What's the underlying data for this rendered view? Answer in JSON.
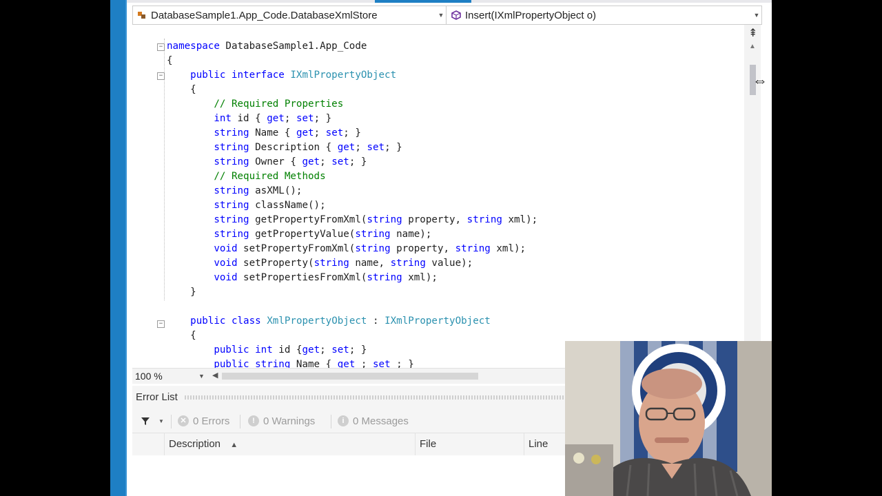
{
  "nav": {
    "left_label": "DatabaseSample1.App_Code.DatabaseXmlStore",
    "right_label": "Insert(IXmlPropertyObject o)"
  },
  "code_lines": [
    {
      "parts": [
        [
          "kw",
          "namespace"
        ],
        [
          "tx",
          " DatabaseSample1.App_Code"
        ]
      ]
    },
    {
      "parts": [
        [
          "tx",
          "{"
        ]
      ]
    },
    {
      "parts": [
        [
          "tx",
          "    "
        ],
        [
          "kw",
          "public"
        ],
        [
          "tx",
          " "
        ],
        [
          "kw",
          "interface"
        ],
        [
          "tx",
          " "
        ],
        [
          "ty",
          "IXmlPropertyObject"
        ]
      ]
    },
    {
      "parts": [
        [
          "tx",
          "    {"
        ]
      ]
    },
    {
      "parts": [
        [
          "tx",
          "        "
        ],
        [
          "cm",
          "// Required Properties"
        ]
      ]
    },
    {
      "parts": [
        [
          "tx",
          "        "
        ],
        [
          "kw",
          "int"
        ],
        [
          "tx",
          " id { "
        ],
        [
          "kw",
          "get"
        ],
        [
          "tx",
          "; "
        ],
        [
          "kw",
          "set"
        ],
        [
          "tx",
          "; }"
        ]
      ]
    },
    {
      "parts": [
        [
          "tx",
          "        "
        ],
        [
          "kw",
          "string"
        ],
        [
          "tx",
          " Name { "
        ],
        [
          "kw",
          "get"
        ],
        [
          "tx",
          "; "
        ],
        [
          "kw",
          "set"
        ],
        [
          "tx",
          "; }"
        ]
      ]
    },
    {
      "parts": [
        [
          "tx",
          "        "
        ],
        [
          "kw",
          "string"
        ],
        [
          "tx",
          " Description { "
        ],
        [
          "kw",
          "get"
        ],
        [
          "tx",
          "; "
        ],
        [
          "kw",
          "set"
        ],
        [
          "tx",
          "; }"
        ]
      ]
    },
    {
      "parts": [
        [
          "tx",
          "        "
        ],
        [
          "kw",
          "string"
        ],
        [
          "tx",
          " Owner { "
        ],
        [
          "kw",
          "get"
        ],
        [
          "tx",
          "; "
        ],
        [
          "kw",
          "set"
        ],
        [
          "tx",
          "; }"
        ]
      ]
    },
    {
      "parts": [
        [
          "tx",
          "        "
        ],
        [
          "cm",
          "// Required Methods"
        ]
      ]
    },
    {
      "parts": [
        [
          "tx",
          "        "
        ],
        [
          "kw",
          "string"
        ],
        [
          "tx",
          " asXML();"
        ]
      ]
    },
    {
      "parts": [
        [
          "tx",
          "        "
        ],
        [
          "kw",
          "string"
        ],
        [
          "tx",
          " className();"
        ]
      ]
    },
    {
      "parts": [
        [
          "tx",
          "        "
        ],
        [
          "kw",
          "string"
        ],
        [
          "tx",
          " getPropertyFromXml("
        ],
        [
          "kw",
          "string"
        ],
        [
          "tx",
          " property, "
        ],
        [
          "kw",
          "string"
        ],
        [
          "tx",
          " xml);"
        ]
      ]
    },
    {
      "parts": [
        [
          "tx",
          "        "
        ],
        [
          "kw",
          "string"
        ],
        [
          "tx",
          " getPropertyValue("
        ],
        [
          "kw",
          "string"
        ],
        [
          "tx",
          " name);"
        ]
      ]
    },
    {
      "parts": [
        [
          "tx",
          "        "
        ],
        [
          "kw",
          "void"
        ],
        [
          "tx",
          " setPropertyFromXml("
        ],
        [
          "kw",
          "string"
        ],
        [
          "tx",
          " property, "
        ],
        [
          "kw",
          "string"
        ],
        [
          "tx",
          " xml);"
        ]
      ]
    },
    {
      "parts": [
        [
          "tx",
          "        "
        ],
        [
          "kw",
          "void"
        ],
        [
          "tx",
          " setProperty("
        ],
        [
          "kw",
          "string"
        ],
        [
          "tx",
          " name, "
        ],
        [
          "kw",
          "string"
        ],
        [
          "tx",
          " value);"
        ]
      ]
    },
    {
      "parts": [
        [
          "tx",
          "        "
        ],
        [
          "kw",
          "void"
        ],
        [
          "tx",
          " setPropertiesFromXml("
        ],
        [
          "kw",
          "string"
        ],
        [
          "tx",
          " xml);"
        ]
      ]
    },
    {
      "parts": [
        [
          "tx",
          "    }"
        ]
      ]
    },
    {
      "parts": [
        [
          "tx",
          ""
        ]
      ]
    },
    {
      "parts": [
        [
          "tx",
          "    "
        ],
        [
          "kw",
          "public"
        ],
        [
          "tx",
          " "
        ],
        [
          "kw",
          "class"
        ],
        [
          "tx",
          " "
        ],
        [
          "ty",
          "XmlPropertyObject"
        ],
        [
          "tx",
          " : "
        ],
        [
          "ty",
          "IXmlPropertyObject"
        ]
      ]
    },
    {
      "parts": [
        [
          "tx",
          "    {"
        ]
      ]
    },
    {
      "parts": [
        [
          "tx",
          "        "
        ],
        [
          "kw",
          "public"
        ],
        [
          "tx",
          " "
        ],
        [
          "kw",
          "int"
        ],
        [
          "tx",
          " id {"
        ],
        [
          "kw",
          "get"
        ],
        [
          "tx",
          "; "
        ],
        [
          "kw",
          "set"
        ],
        [
          "tx",
          "; }"
        ]
      ]
    },
    {
      "parts": [
        [
          "tx",
          "        "
        ],
        [
          "kw",
          "public"
        ],
        [
          "tx",
          " "
        ],
        [
          "kw",
          "string"
        ],
        [
          "tx",
          " Name { "
        ],
        [
          "kw",
          "get"
        ],
        [
          "tx",
          " ; "
        ],
        [
          "kw",
          "set"
        ],
        [
          "tx",
          " ; }"
        ]
      ]
    }
  ],
  "fold_markers": [
    "−",
    "−",
    "−"
  ],
  "zoom": "100 %",
  "error_list": {
    "title": "Error List",
    "errors": "0 Errors",
    "warnings": "0 Warnings",
    "messages": "0 Messages",
    "columns": [
      "Description",
      "File",
      "Line"
    ]
  },
  "colors": {
    "keyword": "#0000ff",
    "type": "#2b91af",
    "comment": "#008000",
    "accent": "#1e7fc4"
  },
  "icons": [
    "class-icon",
    "method-icon",
    "filter-icon",
    "error-icon",
    "warning-icon",
    "message-icon",
    "sort-ascending-icon"
  ]
}
